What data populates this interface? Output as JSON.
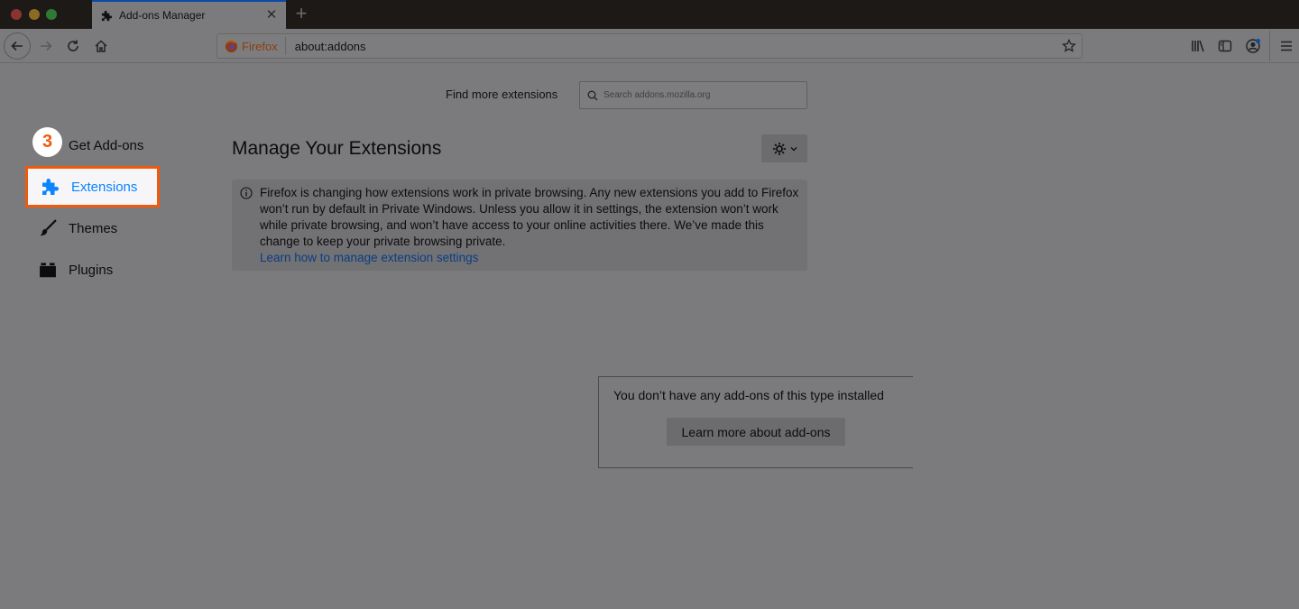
{
  "window": {
    "traffic_lights": [
      "close",
      "minimize",
      "zoom"
    ]
  },
  "tab": {
    "title": "Add-ons Manager",
    "icon": "puzzle-icon",
    "close_glyph": "✕",
    "new_tab_glyph": "+"
  },
  "navbar": {
    "identity_label": "Firefox",
    "url": "about:addons",
    "icons": [
      "back-icon",
      "forward-icon",
      "reload-icon",
      "home-icon",
      "bookmark-star-icon",
      "library-icon",
      "sidebar-icon",
      "account-icon",
      "menu-icon"
    ]
  },
  "search": {
    "label": "Find more extensions",
    "placeholder": "Search addons.mozilla.org"
  },
  "sidebar": {
    "step_badge": "3",
    "items": [
      {
        "label": "Get Add-ons",
        "icon": "get-addons-icon",
        "active": false
      },
      {
        "label": "Extensions",
        "icon": "puzzle-icon",
        "active": true
      },
      {
        "label": "Themes",
        "icon": "brush-icon",
        "active": false
      },
      {
        "label": "Plugins",
        "icon": "plugin-icon",
        "active": false
      }
    ]
  },
  "main": {
    "title": "Manage Your Extensions",
    "gear_menu_icon": "gear-icon",
    "notice": {
      "text": "Firefox is changing how extensions work in private browsing. Any new extensions you add to Firefox won’t run by default in Private Windows. Unless you allow it in settings, the extension won’t work while private browsing, and won’t have access to your online activities there. We’ve made this change to keep your private browsing private.",
      "link": "Learn how to manage extension settings"
    },
    "empty_state": {
      "text": "You don’t have any add-ons of this type installed",
      "button": "Learn more about add-ons"
    }
  },
  "colors": {
    "highlight_border": "#f05a0d",
    "active_text": "#0a84ff",
    "tab_accent": "#0a4aa6"
  }
}
